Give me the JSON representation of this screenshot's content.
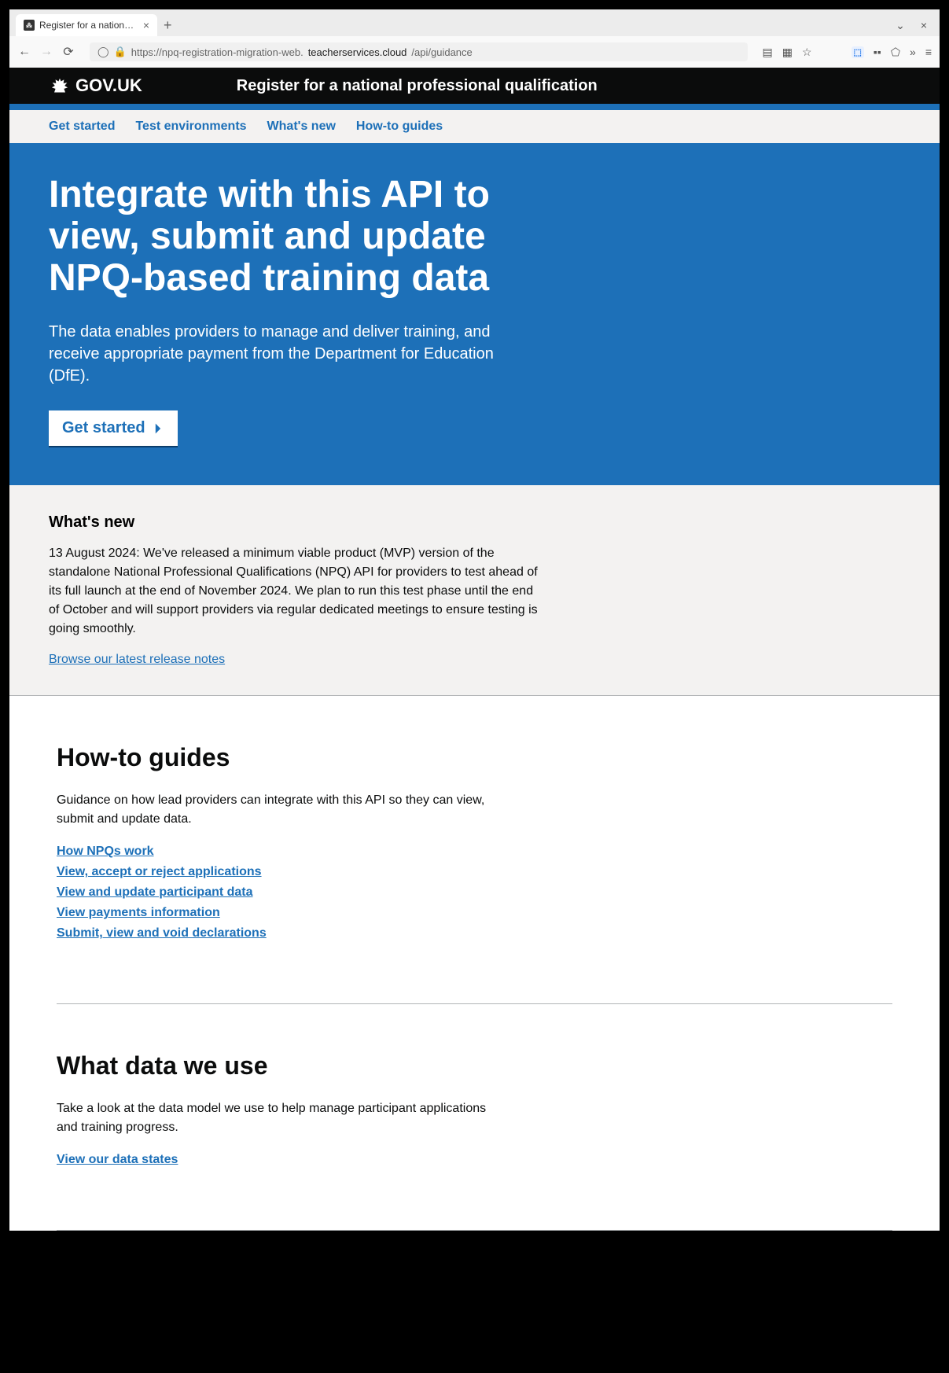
{
  "browser": {
    "tab_title": "Register for a national prc",
    "url_prefix": "https://npq-registration-migration-web.",
    "url_domain": "teacherservices.cloud",
    "url_suffix": "/api/guidance"
  },
  "header": {
    "govuk": "GOV.UK",
    "service": "Register for a national professional qualification"
  },
  "nav": {
    "get_started": "Get started",
    "test_env": "Test environments",
    "whats_new": "What's new",
    "howto": "How-to guides"
  },
  "hero": {
    "title": "Integrate with this API to view, submit and update NPQ-based training data",
    "desc": "The data enables providers to manage and deliver training, and receive appropriate payment from the Department for Education (DfE).",
    "button": "Get started"
  },
  "whats_new": {
    "heading": "What's new",
    "body": "13 August 2024: We've released a minimum viable product (MVP) version of the standalone National Professional Qualifications (NPQ) API for providers to test ahead of its full launch at the end of November 2024. We plan to run this test phase until the end of October and will support providers via regular dedicated meetings to ensure testing is going smoothly.",
    "link": "Browse our latest release notes"
  },
  "howto": {
    "heading": "How-to guides",
    "desc": "Guidance on how lead providers can integrate with this API so they can view, submit and update data.",
    "links": [
      "How NPQs work",
      "View, accept or reject applications",
      "View and update participant data",
      "View payments information",
      "Submit, view and void declarations"
    ]
  },
  "data_use": {
    "heading": "What data we use",
    "desc": "Take a look at the data model we use to help manage participant applications and training progress.",
    "link": "View our data states"
  }
}
